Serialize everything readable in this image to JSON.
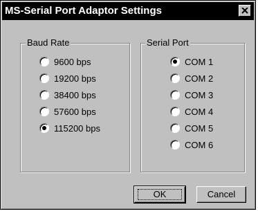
{
  "window": {
    "title": "MS-Serial Port Adaptor Settings"
  },
  "baud_rate": {
    "label": "Baud Rate",
    "options": [
      "9600 bps",
      "19200 bps",
      "38400 bps",
      "57600 bps",
      "115200 bps"
    ],
    "selected": "115200 bps"
  },
  "serial_port": {
    "label": "Serial Port",
    "options": [
      "COM 1",
      "COM 2",
      "COM 3",
      "COM 4",
      "COM 5",
      "COM 6"
    ],
    "selected": "COM 1"
  },
  "buttons": {
    "ok": "OK",
    "cancel": "Cancel"
  }
}
